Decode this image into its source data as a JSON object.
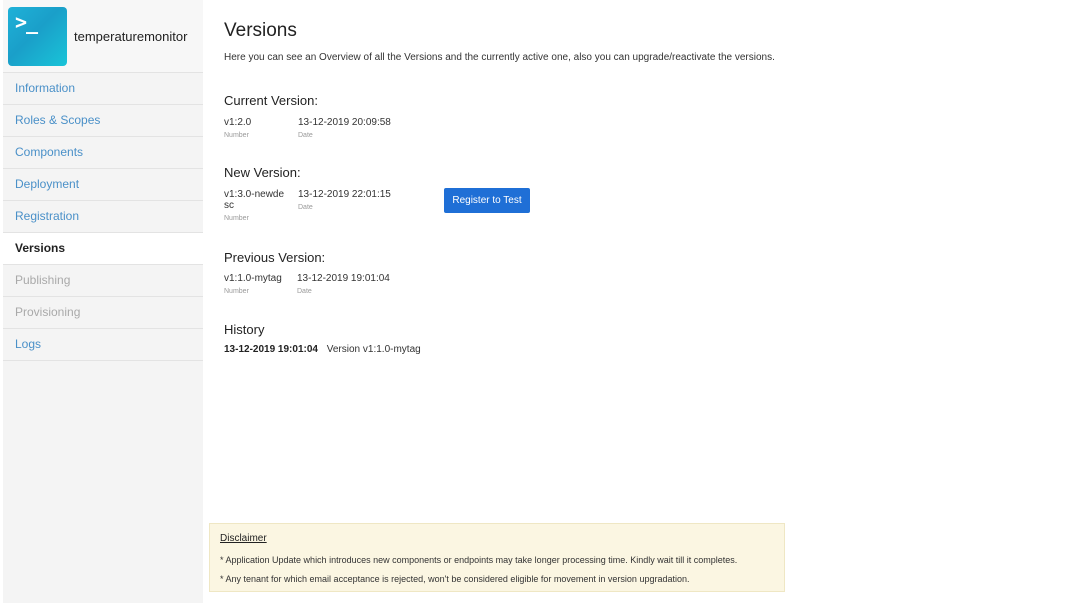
{
  "app": {
    "name": "temperaturemonitor",
    "logo_glyph": ">_",
    "logo_icon": "terminal-prompt-icon",
    "colors": {
      "logo_gradient_start": "#1fb1d8",
      "logo_gradient_end": "#19c4d8"
    }
  },
  "sidebar": {
    "items": [
      {
        "label": "Information",
        "state": "link"
      },
      {
        "label": "Roles & Scopes",
        "state": "link"
      },
      {
        "label": "Components",
        "state": "link"
      },
      {
        "label": "Deployment",
        "state": "link"
      },
      {
        "label": "Registration",
        "state": "link"
      },
      {
        "label": "Versions",
        "state": "active"
      },
      {
        "label": "Publishing",
        "state": "disabled"
      },
      {
        "label": "Provisioning",
        "state": "disabled"
      },
      {
        "label": "Logs",
        "state": "link"
      }
    ]
  },
  "page": {
    "title": "Versions",
    "intro": "Here you can see an Overview of all the Versions and the currently active one, also you can upgrade/reactivate the versions."
  },
  "current_version": {
    "heading": "Current Version:",
    "number": "v1:2.0",
    "number_label": "Number",
    "date": "13-12-2019 20:09:58",
    "date_label": "Date"
  },
  "new_version": {
    "heading": "New Version:",
    "number": "v1:3.0-newdesc",
    "number_label": "Number",
    "date": "13-12-2019 22:01:15",
    "date_label": "Date",
    "action_label": "Register to Test"
  },
  "previous_version": {
    "heading": "Previous Version:",
    "number": "v1:1.0-mytag",
    "number_label": "Number",
    "date": "13-12-2019 19:01:04",
    "date_label": "Date"
  },
  "history": {
    "heading": "History",
    "entries": [
      {
        "date": "13-12-2019 19:01:04",
        "text": "Version v1:1.0-mytag"
      }
    ]
  },
  "disclaimer": {
    "title": "Disclaimer",
    "lines": [
      "* Application Update which introduces new components or endpoints may take longer processing time. Kindly wait till it completes.",
      "* Any tenant for which email acceptance is rejected, won't be considered eligible for movement in version upgradation."
    ]
  },
  "colors": {
    "link": "#4a90c8",
    "primary_button": "#1f6fd6",
    "disclaimer_bg": "#fbf6e2"
  }
}
